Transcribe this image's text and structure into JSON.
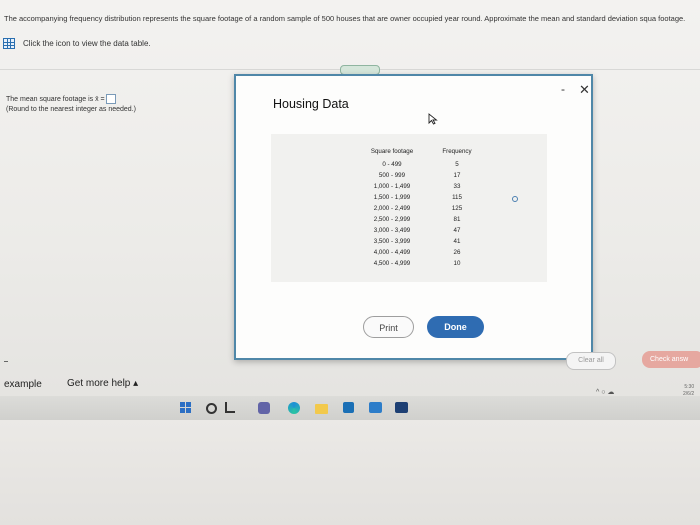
{
  "question": {
    "prompt": "The accompanying frequency distribution represents the square footage of a random sample of 500 houses that are owner occupied year round. Approximate the mean and standard deviation squa footage.",
    "data_link_label": "Click the icon to view the data table.",
    "mean_line": "The mean square footage is x̄ =",
    "rounding_note": "(Round to the nearest integer as needed.)"
  },
  "modal": {
    "title": "Housing Data",
    "minimize_glyph": "-",
    "close_glyph": "✕",
    "table": {
      "headers": [
        "Square footage",
        "Frequency"
      ],
      "rows": [
        {
          "range": "0 - 499",
          "freq": "5"
        },
        {
          "range": "500 - 999",
          "freq": "17"
        },
        {
          "range": "1,000 - 1,499",
          "freq": "33"
        },
        {
          "range": "1,500 - 1,999",
          "freq": "115"
        },
        {
          "range": "2,000 - 2,499",
          "freq": "125"
        },
        {
          "range": "2,500 - 2,999",
          "freq": "81"
        },
        {
          "range": "3,000 - 3,499",
          "freq": "47"
        },
        {
          "range": "3,500 - 3,999",
          "freq": "41"
        },
        {
          "range": "4,000 - 4,499",
          "freq": "26"
        },
        {
          "range": "4,500 - 4,999",
          "freq": "10"
        }
      ]
    },
    "print_label": "Print",
    "done_label": "Done"
  },
  "footer": {
    "example_label": "example",
    "help_label": "Get more help",
    "help_caret": "▴",
    "clear_all_label": "Clear all",
    "check_answer_label": "Check answ"
  },
  "taskbar": {
    "tray_text": "^ ○ ☁",
    "clock_time": "5:30",
    "clock_date": "2/6/2"
  },
  "colors": {
    "modal_border": "#4f87a8",
    "done_button": "#2f6cb2",
    "check_answer": "#e6a8a0"
  },
  "icons": [
    "table-icon",
    "cursor-icon",
    "windows-icon",
    "search-icon",
    "task-view-icon",
    "teams-icon",
    "edge-icon",
    "file-explorer-icon",
    "store-icon",
    "mail-icon",
    "app-icon"
  ]
}
